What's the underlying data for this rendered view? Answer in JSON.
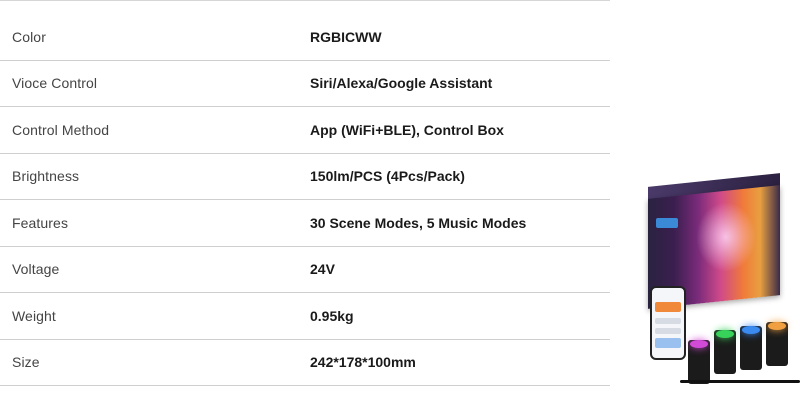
{
  "specs": [
    {
      "label": "Color",
      "value": "RGBICWW"
    },
    {
      "label": "Vioce Control",
      "value": "Siri/Alexa/Google Assistant"
    },
    {
      "label": "Control Method",
      "value": "App (WiFi+BLE), Control Box"
    },
    {
      "label": "Brightness",
      "value": "150lm/PCS (4Pcs/Pack)"
    },
    {
      "label": "Features",
      "value": "30 Scene Modes, 5 Music Modes"
    },
    {
      "label": "Voltage",
      "value": "24V"
    },
    {
      "label": "Weight",
      "value": "0.95kg"
    },
    {
      "label": "Size",
      "value": "242*178*100mm"
    }
  ],
  "product_image": {
    "light_colors": [
      "#d24bd6",
      "#37d25a",
      "#3b8af0",
      "#f0a040"
    ]
  }
}
